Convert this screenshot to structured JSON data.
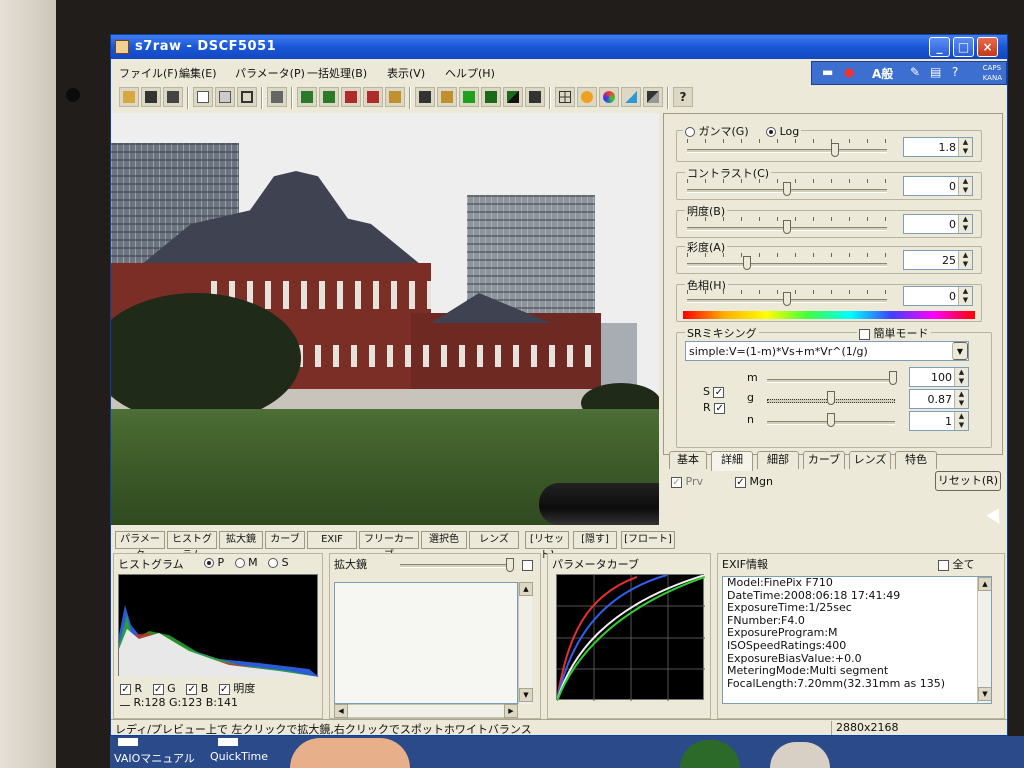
{
  "window": {
    "title": "s7raw - DSCF5051"
  },
  "ime": {
    "mode": "A般",
    "caps": "CAPS",
    "kana": "KANA"
  },
  "menu": [
    {
      "label": "ファイル(F)"
    },
    {
      "label": "編集(E)"
    },
    {
      "label": "パラメータ(P)"
    },
    {
      "label": "一括処理(B)"
    },
    {
      "label": "表示(V)"
    },
    {
      "label": "ヘルプ(H)"
    }
  ],
  "toolbar_icons": [
    "open-icon",
    "save-icon",
    "save-as-icon",
    "copy-icon",
    "paste-icon",
    "crop-icon",
    "stack-icon",
    "tiff-icon",
    "raw-icon",
    "jpg-icon",
    "png-icon",
    "bmp-icon",
    "batch-icon",
    "green-square-icon",
    "grid-icon",
    "split-icon",
    "prev-icon",
    "layout-icon",
    "sun-icon",
    "color-icon",
    "sharpen-icon",
    "compare-icon",
    "help-icon"
  ],
  "adjust": {
    "gamma": {
      "radio1": "ガンマ(G)",
      "radio2": "Log",
      "selected": "Log",
      "value": "1.8"
    },
    "contrast": {
      "label": "コントラスト(C)",
      "value": "0"
    },
    "brightness": {
      "label": "明度(B)",
      "value": "0"
    },
    "saturation": {
      "label": "彩度(A)",
      "value": "25"
    },
    "hue": {
      "label": "色相(H)",
      "value": "0"
    },
    "sr": {
      "label": "SRミキシング",
      "simple_mode": "簡単モード",
      "formula": "simple:V=(1-m)*Vs+m*Vr^(1/g)",
      "s_label": "S",
      "r_label": "R",
      "m_label": "m",
      "g_label": "g",
      "n_label": "n",
      "m_value": "100",
      "g_value": "0.87",
      "n_value": "1"
    }
  },
  "tabs": [
    "基本",
    "詳細",
    "細部",
    "カーブ",
    "レンズ",
    "特色"
  ],
  "options": {
    "prv": "Prv",
    "mgn": "Mgn",
    "reset": "リセット(R)"
  },
  "bottom_tabs": [
    "パラメータ",
    "ヒストグラム",
    "拡大鏡",
    "カーブ",
    "EXIF",
    "フリーカーブ",
    "選択色",
    "レンズ",
    "[リセット]",
    "[隠す]",
    "[フロート]"
  ],
  "histogram": {
    "title": "ヒストグラム",
    "modes": [
      "P",
      "M",
      "S"
    ],
    "selected": "P",
    "channels": [
      "R",
      "G",
      "B",
      "明度"
    ],
    "readout": "R:128 G:123 B:141"
  },
  "magnifier": {
    "title": "拡大鏡"
  },
  "curve": {
    "title": "パラメータカーブ"
  },
  "exif": {
    "title": "EXIF情報",
    "all_label": "全て",
    "lines": [
      "Model:FinePix F710",
      "DateTime:2008:06:18 17:41:49",
      "ExposureTime:1/25sec",
      "FNumber:F4.0",
      "ExposureProgram:M",
      "ISOSpeedRatings:400",
      "ExposureBiasValue:+0.0",
      "MeteringMode:Multi segment",
      "FocalLength:7.20mm(32.31mm as 135)"
    ]
  },
  "status": {
    "hint": "レディ/プレビュー上で 左クリックで拡大鏡,右クリックでスポットホワイトバランス",
    "size": "2880x2168"
  },
  "desktop": {
    "icon1": "VAIOマニュアル",
    "icon2": "QuickTime"
  }
}
